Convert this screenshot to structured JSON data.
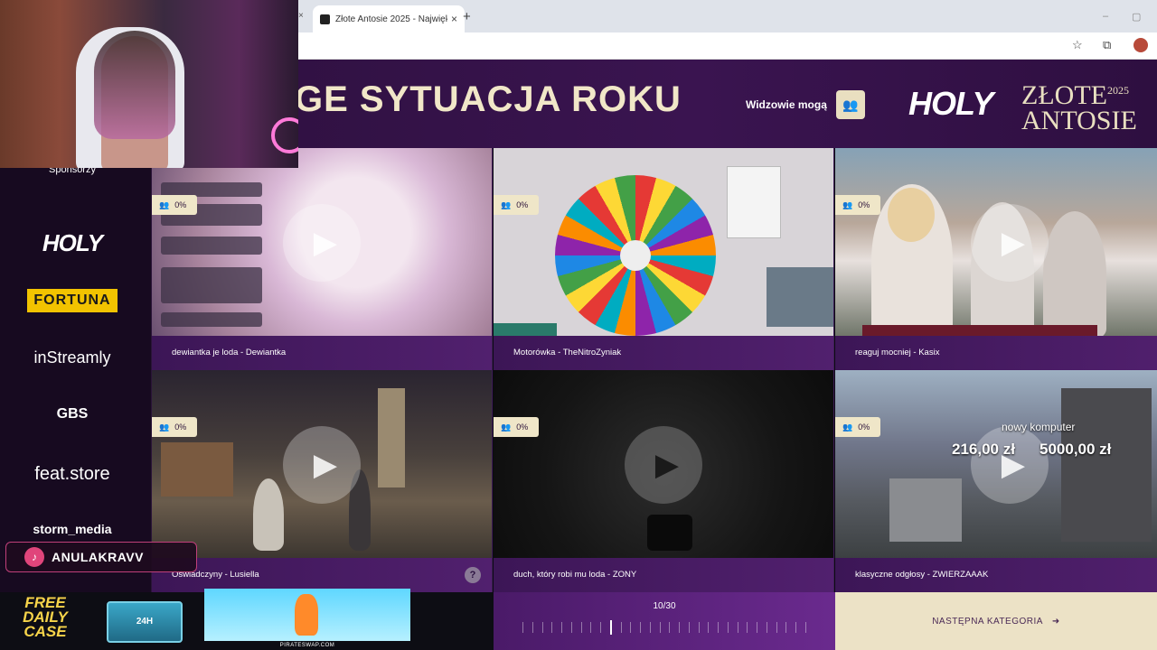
{
  "browser": {
    "tab_title": "Złote Antosie 2025 - Największ",
    "tab_close": "×",
    "prev_tab_close": "×",
    "new_tab": "+",
    "min": "–",
    "max": "▢"
  },
  "header": {
    "category_title": "GE SYTUACJA ROKU",
    "viewers_label": "Widzowie mogą",
    "holy_logo": "HOLY",
    "zlote_line1": "ZŁOTE",
    "zlote_year": "2025",
    "zlote_line2": "ANTOSIE"
  },
  "sidebar": {
    "sponsors_label": "Sponsorzy",
    "sponsors": [
      "HOLY",
      "FORTUNA",
      "inStreamly",
      "GBS",
      "feat.store",
      "storm_media"
    ]
  },
  "cards": [
    {
      "label": "dewiantka je loda - Dewiantka",
      "vote": "0%"
    },
    {
      "label": "Motorówka - TheNitroZyniak",
      "vote": "0%"
    },
    {
      "label": "reaguj mocniej - Kasix",
      "vote": "0%"
    },
    {
      "label": "Oświadczyny - Lusiella",
      "vote": "0%"
    },
    {
      "label": "duch, który robi mu loda - ZONY",
      "vote": "0%"
    },
    {
      "label": "klasyczne odgłosy - ZWIERZAAAK",
      "vote": "0%"
    }
  ],
  "overlays": {
    "mc_title": "nowy komputer",
    "mc_price1": "216,00 zł",
    "mc_price2": "5000,00 zł",
    "help": "?"
  },
  "pager": {
    "text": "10/30",
    "current": 10,
    "total": 30
  },
  "next_category": "NASTĘPNA KATEGORIA",
  "ad": {
    "case_text": "FREE DAILY CASE",
    "crate_text": "24H",
    "url": "PIRATESWAP.COM"
  },
  "tiktok": {
    "name": "ANULAKRAVV"
  },
  "colors": {
    "header_bg": "#3a1450",
    "accent_cream": "#efe6c8",
    "label_bg": "#51206e"
  }
}
